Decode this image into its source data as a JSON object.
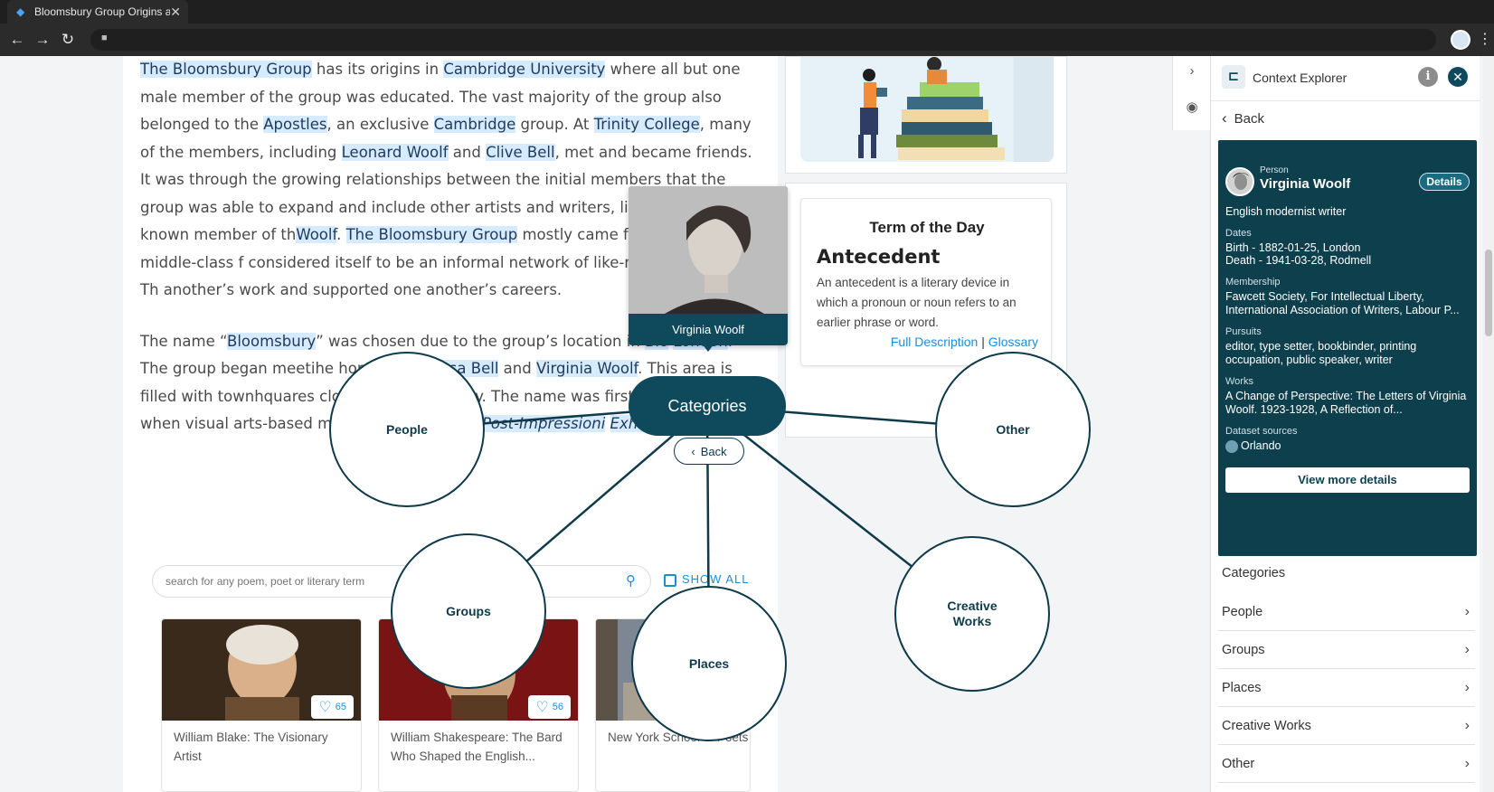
{
  "browser": {
    "tab_title": "Bloomsbury Group Origins and",
    "tab_close": "✕"
  },
  "article": {
    "p1": [
      {
        "t": "The Bloomsbury Group",
        "hl": true
      },
      {
        "t": " has its origins in ",
        "hl": false
      },
      {
        "t": "Cambridge University",
        "hl": true
      },
      {
        "t": " where all but one male member of the group was educated. The vast majority of the group also belonged to the ",
        "hl": false
      },
      {
        "t": "Apostles",
        "hl": true
      },
      {
        "t": ", an exclusive ",
        "hl": false
      },
      {
        "t": "Cambridge",
        "hl": true
      },
      {
        "t": " group. At ",
        "hl": false
      },
      {
        "t": "Trinity College",
        "hl": true
      },
      {
        "t": ", many of the members, including ",
        "hl": false
      },
      {
        "t": "Leonard Woolf",
        "hl": true
      },
      {
        "t": " and ",
        "hl": false
      },
      {
        "t": "Clive Bell",
        "hl": true
      },
      {
        "t": ", met and became friends. It was through the growing relationships between the initial members that the group was able to expand and include other artists and writers, like the best-known member of th",
        "hl": false
      },
      {
        "t": "",
        "hl": false
      },
      {
        "t": "Woolf",
        "hl": true
      },
      {
        "t": ". ",
        "hl": false
      },
      {
        "t": "The Bloomsbury Group",
        "hl": true
      },
      {
        "t": " mostly came from upper-middle-class f",
        "hl": false
      },
      {
        "t": " considered itself to be an informal network of like-minded thinkers. Th",
        "hl": false
      },
      {
        "t": " another’s work and supported one another’s careers.",
        "hl": false
      }
    ],
    "p2": [
      {
        "t": "The name “",
        "hl": false
      },
      {
        "t": "Bloomsbury",
        "hl": true
      },
      {
        "t": "” was chosen due to the group’s location in ",
        "hl": false
      },
      {
        "t": "Blo",
        "hl": true
      },
      {
        "t": " ",
        "hl": false
      },
      {
        "t": "London",
        "hl": true
      },
      {
        "t": ". The group began meeti",
        "hl": false
      },
      {
        "t": "he home of ",
        "hl": false
      },
      {
        "t": "Vanessa Bell",
        "hl": true
      },
      {
        "t": " and ",
        "hl": false
      },
      {
        "t": "Virginia Woolf",
        "hl": true
      },
      {
        "t": ". This area is filled with townh",
        "hl": false
      },
      {
        "t": "quares closely associat",
        "hl": false
      },
      {
        "t": " today. The name was first u",
        "hl": false
      },
      {
        "t": " group in 1912 when",
        "hl": false
      },
      {
        "t": " visual arts-based members",
        "hl": false
      },
      {
        "t": " the ",
        "hl": false
      },
      {
        "t": "Second Post-Impressioni",
        "hl": true,
        "it": true
      },
      {
        "t": " ",
        "hl": false
      },
      {
        "t": "Exhibition",
        "hl": true,
        "it": true
      },
      {
        "t": ".",
        "hl": false
      }
    ]
  },
  "term_of_day": {
    "heading": "Term of the Day",
    "term": "Antecedent",
    "description": "An antecedent is a literary device in which a pronoun or noun refers to an earlier phrase or word.",
    "full_description": "Full Description",
    "separator": "|",
    "glossary": "Glossary"
  },
  "search": {
    "placeholder": "search for any poem, poet or literary term",
    "show_all": "SHOW ALL"
  },
  "poems": [
    {
      "title": "William Blake: The Visionary Artist",
      "likes": "65"
    },
    {
      "title": "William Shakespeare: The Bard Who Shaped the English...",
      "likes": "56"
    },
    {
      "title": "New York School of Poets",
      "likes": ""
    }
  ],
  "graph": {
    "center": "Categories",
    "back": "Back",
    "portrait_caption": "Virginia Woolf",
    "nodes": {
      "people": "People",
      "groups": "Groups",
      "places": "Places",
      "creative_works": "Creative Works",
      "other": "Other"
    }
  },
  "panel": {
    "title": "Context Explorer",
    "back": "Back",
    "person": {
      "type": "Person",
      "name": "Virginia Woolf",
      "details": "Details",
      "description": "English modernist writer",
      "dates_label": "Dates",
      "birth": "Birth - 1882-01-25, London",
      "death": "Death - 1941-03-28, Rodmell",
      "membership_label": "Membership",
      "membership": "Fawcett Society, For Intellectual Liberty, International Association of Writers, Labour P...",
      "pursuits_label": "Pursuits",
      "pursuits": "editor, type setter, bookbinder, printing occupation, public speaker, writer",
      "works_label": "Works",
      "works": "A Change of Perspective: The Letters of Virginia Woolf. 1923-1928, A Reflection of...",
      "sources_label": "Dataset sources",
      "source": "Orlando",
      "view_more": "View more details"
    },
    "categories_heading": "Categories",
    "categories": [
      "People",
      "Groups",
      "Places",
      "Creative Works",
      "Other"
    ]
  },
  "colors": {
    "accent": "#0e4a5c",
    "highlight": "#d6ebff",
    "link": "#1a8fd6"
  }
}
